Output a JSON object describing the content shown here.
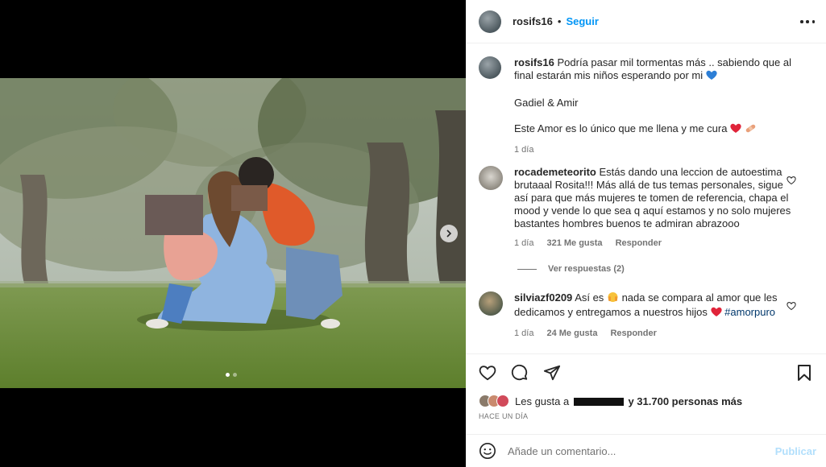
{
  "post": {
    "username": "rosifs16",
    "separator": "•",
    "follow_label": "Seguir",
    "caption": {
      "username": "rosifs16",
      "line1": "Podría pasar mil tormentas más .. sabiendo que al final estarán mis niños esperando por mi",
      "line2": "Gadiel & Amir",
      "line3": "Este Amor es lo único que me llena y me cura",
      "time": "1 día"
    },
    "carousel": {
      "count": 2,
      "active": 0
    }
  },
  "comments": [
    {
      "username": "rocademeteorito",
      "text": "Estás dando una leccion de autoestima brutaaal Rosita!!! Más allá de tus temas personales, sigue así para que más mujeres te tomen de referencia, chapa el mood y vende lo que sea q aquí estamos y no solo mujeres bastantes hombres buenos te admiran abrazooo",
      "time": "1 día",
      "likes": "321 Me gusta",
      "reply_label": "Responder",
      "view_replies": "Ver respuestas (2)"
    },
    {
      "username": "silviazf0209",
      "text_before": "Así es",
      "text_middle": "nada se compara al amor que les dedicamos y entregamos a nuestros hijos",
      "hashtag": "#amorpuro",
      "time": "1 día",
      "likes": "24 Me gusta",
      "reply_label": "Responder"
    }
  ],
  "likes": {
    "prefix": "Les gusta a",
    "suffix": "y 31.700 personas más",
    "time_ago": "HACE UN DÍA"
  },
  "add_comment": {
    "placeholder": "Añade un comentario...",
    "post_label": "Publicar"
  },
  "colors": {
    "accent": "#0095f6",
    "text": "#262626",
    "muted": "#737373",
    "hashtag": "#00376b",
    "post_disabled": "#b2dffc"
  },
  "icons": [
    "more-icon",
    "heart-icon",
    "comment-icon",
    "share-icon",
    "bookmark-icon",
    "emoji-icon",
    "chevron-right-icon"
  ]
}
